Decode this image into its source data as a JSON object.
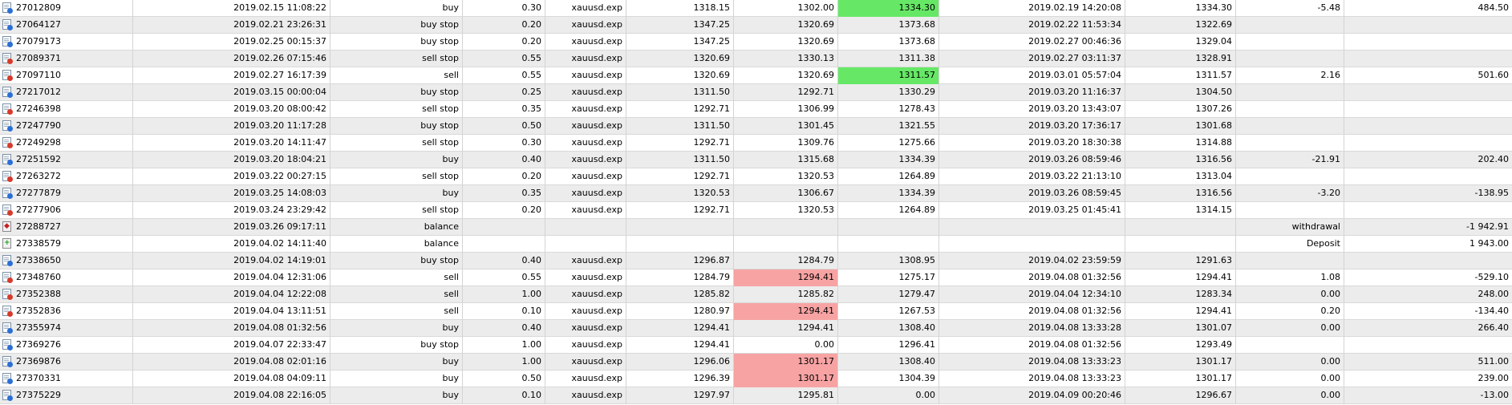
{
  "colors": {
    "highlight_green": "#66e866",
    "highlight_red": "#f7a3a3",
    "row_alt": "#ececec"
  },
  "rows": [
    {
      "ticket": "27012809",
      "icon": "order-buy-icon",
      "time": "2019.02.15 11:08:22",
      "type": "buy",
      "volume": "0.30",
      "symbol": "xauusd.exp",
      "price": "1318.15",
      "sl": "1302.00",
      "tp": "1334.30",
      "close_time": "2019.02.19 14:20:08",
      "close_price": "1334.30",
      "commission": "-5.48",
      "profit": "484.50",
      "sl_hl": "",
      "tp_hl": "green"
    },
    {
      "ticket": "27064127",
      "icon": "order-buy-icon",
      "time": "2019.02.21 23:26:31",
      "type": "buy stop",
      "volume": "0.20",
      "symbol": "xauusd.exp",
      "price": "1347.25",
      "sl": "1320.69",
      "tp": "1373.68",
      "close_time": "2019.02.22 11:53:34",
      "close_price": "1322.69",
      "commission": "",
      "profit": "",
      "sl_hl": "",
      "tp_hl": ""
    },
    {
      "ticket": "27079173",
      "icon": "order-buy-icon",
      "time": "2019.02.25 00:15:37",
      "type": "buy stop",
      "volume": "0.20",
      "symbol": "xauusd.exp",
      "price": "1347.25",
      "sl": "1320.69",
      "tp": "1373.68",
      "close_time": "2019.02.27 00:46:36",
      "close_price": "1329.04",
      "commission": "",
      "profit": "",
      "sl_hl": "",
      "tp_hl": ""
    },
    {
      "ticket": "27089371",
      "icon": "order-sell-icon",
      "time": "2019.02.26 07:15:46",
      "type": "sell stop",
      "volume": "0.55",
      "symbol": "xauusd.exp",
      "price": "1320.69",
      "sl": "1330.13",
      "tp": "1311.38",
      "close_time": "2019.02.27 03:11:37",
      "close_price": "1328.91",
      "commission": "",
      "profit": "",
      "sl_hl": "",
      "tp_hl": ""
    },
    {
      "ticket": "27097110",
      "icon": "order-sell-icon",
      "time": "2019.02.27 16:17:39",
      "type": "sell",
      "volume": "0.55",
      "symbol": "xauusd.exp",
      "price": "1320.69",
      "sl": "1320.69",
      "tp": "1311.57",
      "close_time": "2019.03.01 05:57:04",
      "close_price": "1311.57",
      "commission": "2.16",
      "profit": "501.60",
      "sl_hl": "",
      "tp_hl": "green"
    },
    {
      "ticket": "27217012",
      "icon": "order-buy-icon",
      "time": "2019.03.15 00:00:04",
      "type": "buy stop",
      "volume": "0.25",
      "symbol": "xauusd.exp",
      "price": "1311.50",
      "sl": "1292.71",
      "tp": "1330.29",
      "close_time": "2019.03.20 11:16:37",
      "close_price": "1304.50",
      "commission": "",
      "profit": "",
      "sl_hl": "",
      "tp_hl": ""
    },
    {
      "ticket": "27246398",
      "icon": "order-sell-icon",
      "time": "2019.03.20 08:00:42",
      "type": "sell stop",
      "volume": "0.35",
      "symbol": "xauusd.exp",
      "price": "1292.71",
      "sl": "1306.99",
      "tp": "1278.43",
      "close_time": "2019.03.20 13:43:07",
      "close_price": "1307.26",
      "commission": "",
      "profit": "",
      "sl_hl": "",
      "tp_hl": ""
    },
    {
      "ticket": "27247790",
      "icon": "order-buy-icon",
      "time": "2019.03.20 11:17:28",
      "type": "buy stop",
      "volume": "0.50",
      "symbol": "xauusd.exp",
      "price": "1311.50",
      "sl": "1301.45",
      "tp": "1321.55",
      "close_time": "2019.03.20 17:36:17",
      "close_price": "1301.68",
      "commission": "",
      "profit": "",
      "sl_hl": "",
      "tp_hl": ""
    },
    {
      "ticket": "27249298",
      "icon": "order-sell-icon",
      "time": "2019.03.20 14:11:47",
      "type": "sell stop",
      "volume": "0.30",
      "symbol": "xauusd.exp",
      "price": "1292.71",
      "sl": "1309.76",
      "tp": "1275.66",
      "close_time": "2019.03.20 18:30:38",
      "close_price": "1314.88",
      "commission": "",
      "profit": "",
      "sl_hl": "",
      "tp_hl": ""
    },
    {
      "ticket": "27251592",
      "icon": "order-buy-icon",
      "time": "2019.03.20 18:04:21",
      "type": "buy",
      "volume": "0.40",
      "symbol": "xauusd.exp",
      "price": "1311.50",
      "sl": "1315.68",
      "tp": "1334.39",
      "close_time": "2019.03.26 08:59:46",
      "close_price": "1316.56",
      "commission": "-21.91",
      "profit": "202.40",
      "sl_hl": "",
      "tp_hl": ""
    },
    {
      "ticket": "27263272",
      "icon": "order-sell-icon",
      "time": "2019.03.22 00:27:15",
      "type": "sell stop",
      "volume": "0.20",
      "symbol": "xauusd.exp",
      "price": "1292.71",
      "sl": "1320.53",
      "tp": "1264.89",
      "close_time": "2019.03.22 21:13:10",
      "close_price": "1313.04",
      "commission": "",
      "profit": "",
      "sl_hl": "",
      "tp_hl": ""
    },
    {
      "ticket": "27277879",
      "icon": "order-buy-icon",
      "time": "2019.03.25 14:08:03",
      "type": "buy",
      "volume": "0.35",
      "symbol": "xauusd.exp",
      "price": "1320.53",
      "sl": "1306.67",
      "tp": "1334.39",
      "close_time": "2019.03.26 08:59:45",
      "close_price": "1316.56",
      "commission": "-3.20",
      "profit": "-138.95",
      "sl_hl": "",
      "tp_hl": ""
    },
    {
      "ticket": "27277906",
      "icon": "order-sell-icon",
      "time": "2019.03.24 23:29:42",
      "type": "sell stop",
      "volume": "0.20",
      "symbol": "xauusd.exp",
      "price": "1292.71",
      "sl": "1320.53",
      "tp": "1264.89",
      "close_time": "2019.03.25 01:45:41",
      "close_price": "1314.15",
      "commission": "",
      "profit": "",
      "sl_hl": "",
      "tp_hl": ""
    },
    {
      "ticket": "27288727",
      "icon": "balance-withdrawal-icon",
      "time": "2019.03.26 09:17:11",
      "type": "balance",
      "volume": "",
      "symbol": "",
      "price": "",
      "sl": "",
      "tp": "",
      "close_time": "",
      "close_price": "",
      "commission": "withdrawal",
      "profit": "-1 942.91",
      "sl_hl": "",
      "tp_hl": ""
    },
    {
      "ticket": "27338579",
      "icon": "balance-deposit-icon",
      "time": "2019.04.02 14:11:40",
      "type": "balance",
      "volume": "",
      "symbol": "",
      "price": "",
      "sl": "",
      "tp": "",
      "close_time": "",
      "close_price": "",
      "commission": "Deposit",
      "profit": "1 943.00",
      "sl_hl": "",
      "tp_hl": ""
    },
    {
      "ticket": "27338650",
      "icon": "order-buy-icon",
      "time": "2019.04.02 14:19:01",
      "type": "buy stop",
      "volume": "0.40",
      "symbol": "xauusd.exp",
      "price": "1296.87",
      "sl": "1284.79",
      "tp": "1308.95",
      "close_time": "2019.04.02 23:59:59",
      "close_price": "1291.63",
      "commission": "",
      "profit": "",
      "sl_hl": "",
      "tp_hl": ""
    },
    {
      "ticket": "27348760",
      "icon": "order-sell-icon",
      "time": "2019.04.04 12:31:06",
      "type": "sell",
      "volume": "0.55",
      "symbol": "xauusd.exp",
      "price": "1284.79",
      "sl": "1294.41",
      "tp": "1275.17",
      "close_time": "2019.04.08 01:32:56",
      "close_price": "1294.41",
      "commission": "1.08",
      "profit": "-529.10",
      "sl_hl": "red",
      "tp_hl": ""
    },
    {
      "ticket": "27352388",
      "icon": "order-sell-icon",
      "time": "2019.04.04 12:22:08",
      "type": "sell",
      "volume": "1.00",
      "symbol": "xauusd.exp",
      "price": "1285.82",
      "sl": "1285.82",
      "tp": "1279.47",
      "close_time": "2019.04.04 12:34:10",
      "close_price": "1283.34",
      "commission": "0.00",
      "profit": "248.00",
      "sl_hl": "",
      "tp_hl": ""
    },
    {
      "ticket": "27352836",
      "icon": "order-sell-icon",
      "time": "2019.04.04 13:11:51",
      "type": "sell",
      "volume": "0.10",
      "symbol": "xauusd.exp",
      "price": "1280.97",
      "sl": "1294.41",
      "tp": "1267.53",
      "close_time": "2019.04.08 01:32:56",
      "close_price": "1294.41",
      "commission": "0.20",
      "profit": "-134.40",
      "sl_hl": "red",
      "tp_hl": ""
    },
    {
      "ticket": "27355974",
      "icon": "order-buy-icon",
      "time": "2019.04.08 01:32:56",
      "type": "buy",
      "volume": "0.40",
      "symbol": "xauusd.exp",
      "price": "1294.41",
      "sl": "1294.41",
      "tp": "1308.40",
      "close_time": "2019.04.08 13:33:28",
      "close_price": "1301.07",
      "commission": "0.00",
      "profit": "266.40",
      "sl_hl": "",
      "tp_hl": ""
    },
    {
      "ticket": "27369276",
      "icon": "order-buy-icon",
      "time": "2019.04.07 22:33:47",
      "type": "buy stop",
      "volume": "1.00",
      "symbol": "xauusd.exp",
      "price": "1294.41",
      "sl": "0.00",
      "tp": "1296.41",
      "close_time": "2019.04.08 01:32:56",
      "close_price": "1293.49",
      "commission": "",
      "profit": "",
      "sl_hl": "",
      "tp_hl": ""
    },
    {
      "ticket": "27369876",
      "icon": "order-buy-icon",
      "time": "2019.04.08 02:01:16",
      "type": "buy",
      "volume": "1.00",
      "symbol": "xauusd.exp",
      "price": "1296.06",
      "sl": "1301.17",
      "tp": "1308.40",
      "close_time": "2019.04.08 13:33:23",
      "close_price": "1301.17",
      "commission": "0.00",
      "profit": "511.00",
      "sl_hl": "red",
      "tp_hl": ""
    },
    {
      "ticket": "27370331",
      "icon": "order-buy-icon",
      "time": "2019.04.08 04:09:11",
      "type": "buy",
      "volume": "0.50",
      "symbol": "xauusd.exp",
      "price": "1296.39",
      "sl": "1301.17",
      "tp": "1304.39",
      "close_time": "2019.04.08 13:33:23",
      "close_price": "1301.17",
      "commission": "0.00",
      "profit": "239.00",
      "sl_hl": "red",
      "tp_hl": ""
    },
    {
      "ticket": "27375229",
      "icon": "order-buy-icon",
      "time": "2019.04.08 22:16:05",
      "type": "buy",
      "volume": "0.10",
      "symbol": "xauusd.exp",
      "price": "1297.97",
      "sl": "1295.81",
      "tp": "0.00",
      "close_time": "2019.04.09 00:20:46",
      "close_price": "1296.67",
      "commission": "0.00",
      "profit": "-13.00",
      "sl_hl": "",
      "tp_hl": ""
    }
  ]
}
